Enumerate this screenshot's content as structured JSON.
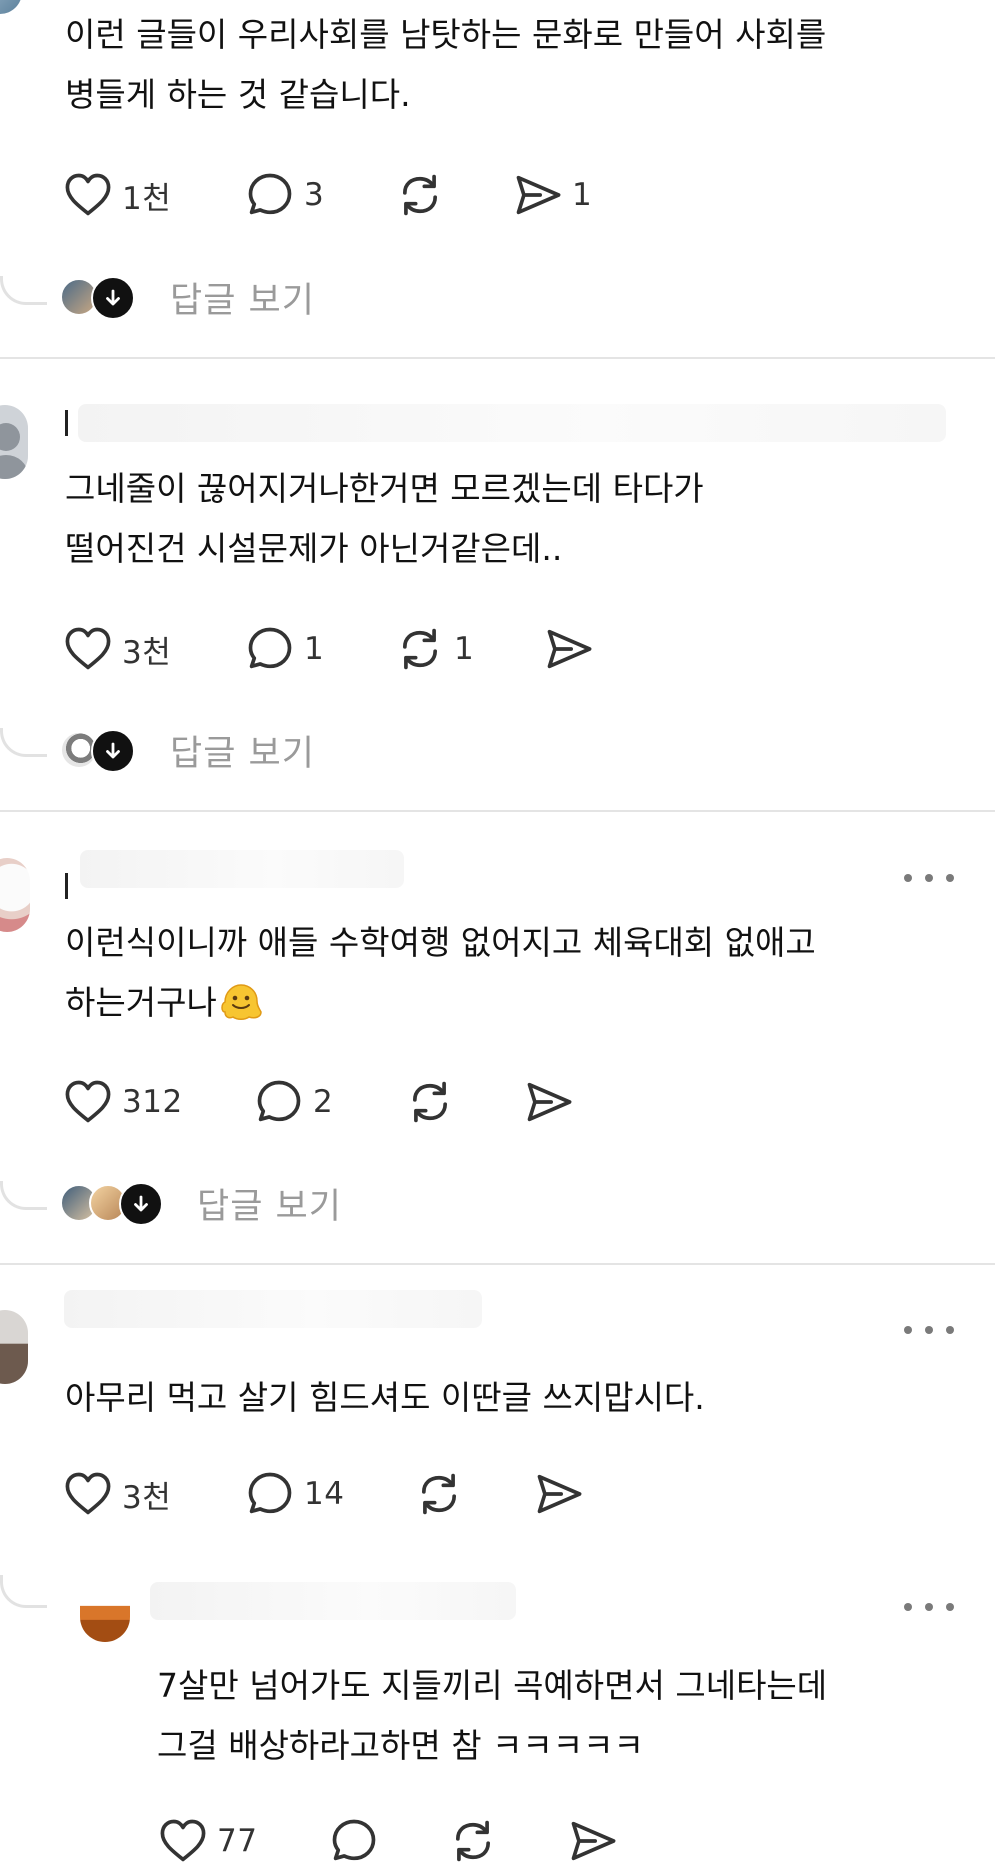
{
  "comments": [
    {
      "lines": [
        "이런 글들이 우리사회를 남탓하는 문화로 만들어 사회를",
        "병들게 하는 것 같습니다."
      ],
      "likes": "1천",
      "replies": "3",
      "reposts": "",
      "shares": "1",
      "view_replies": "답글 보기"
    },
    {
      "lines": [
        "그네줄이 끊어지거나한거면 모르겠는데 타다가",
        "떨어진건 시설문제가 아닌거같은데.."
      ],
      "likes": "3천",
      "replies": "1",
      "reposts": "1",
      "shares": "",
      "view_replies": "답글 보기"
    },
    {
      "lines": [
        "이런식이니까 애들 수학여행 없어지고 체육대회 없애고",
        "하는거구나"
      ],
      "likes": "312",
      "replies": "2",
      "reposts": "",
      "shares": "",
      "view_replies": "답글 보기"
    },
    {
      "lines": [
        "아무리 먹고 살기 힘드셔도 이딴글 쓰지맙시다."
      ],
      "likes": "3천",
      "replies": "14",
      "reposts": "",
      "shares": ""
    },
    {
      "lines": [
        "7살만 넘어가도 지들끼리 곡예하면서 그네타는데",
        "그걸 배상하라고하면 참 ㅋㅋㅋㅋㅋ"
      ],
      "likes": "77",
      "replies": "",
      "reposts": "",
      "shares": ""
    }
  ],
  "icons": {
    "like": "heart-icon",
    "reply": "speech-bubble-icon",
    "repost": "repost-icon",
    "share": "send-icon",
    "more": "more-dots-icon",
    "expand": "arrow-down-icon"
  },
  "colors": {
    "text": "#111111",
    "muted": "#9a9a9a",
    "divider": "#e4e4e4",
    "icon": "#3a3a3a"
  }
}
